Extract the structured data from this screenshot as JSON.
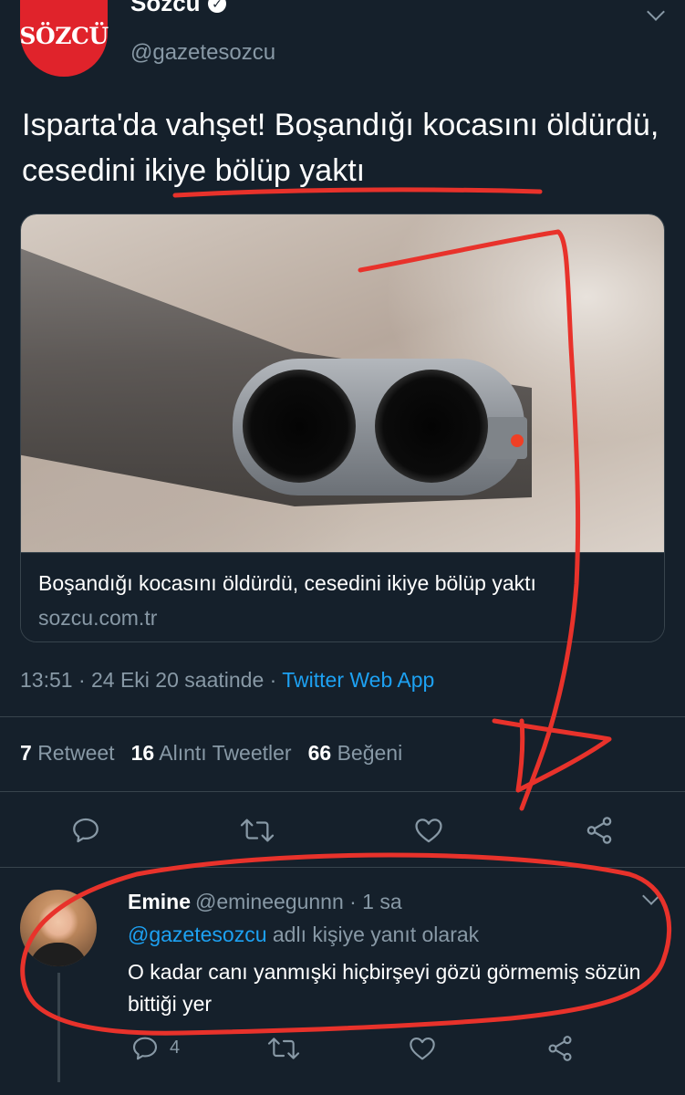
{
  "tweet": {
    "logo_text": "SÖZCÜ",
    "display_name": "Sözcü",
    "handle": "@gazetesozcu",
    "text": "Isparta'da vahşet! Boşandığı kocasını öldürdü, cesedini ikiye bölüp yaktı",
    "card": {
      "title": "Boşandığı kocasını öldürdü, cesedini ikiye bölüp yaktı",
      "domain": "sozcu.com.tr"
    },
    "timestamp": "13:51 · 24 Eki 20 saatinde · ",
    "source_app": "Twitter Web App",
    "stats": {
      "retweets_count": "7",
      "retweets_label": "Retweet",
      "quotes_count": "16",
      "quotes_label": "Alıntı Tweetler",
      "likes_count": "66",
      "likes_label": "Beğeni"
    }
  },
  "reply": {
    "name": "Emine",
    "handle_time": "@emineegunnn · 1 sa",
    "replying_to_mention": "@gazetesozcu",
    "replying_to_suffix": " adlı kişiye yanıt olarak",
    "text": "O kadar canı yanmışki hiçbirşeyi gözü görmemiş sözün bittiği yer",
    "reply_count": "4"
  },
  "icons": {
    "reply": "reply-icon",
    "retweet": "retweet-icon",
    "like": "heart-icon",
    "share": "share-icon",
    "menu": "chevron-down-icon",
    "verified": "verified-badge-icon"
  },
  "colors": {
    "background": "#15202b",
    "muted": "#8899a6",
    "link": "#1da1f2",
    "divider": "#38444d",
    "annotation": "#e8322b",
    "brand": "#e0232b"
  }
}
